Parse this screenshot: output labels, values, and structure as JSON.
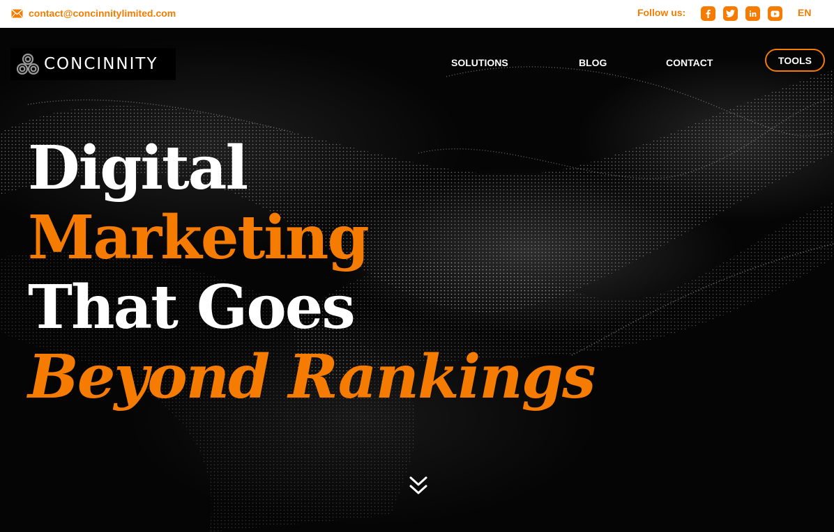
{
  "topbar": {
    "email": "contact@concinnitylimited.com",
    "email_icon": "mail-icon",
    "follow_label": "Follow us:",
    "social_icons": [
      "facebook-icon",
      "twitter-icon",
      "linkedin-icon",
      "youtube-icon"
    ],
    "language": "EN"
  },
  "brand": {
    "name": "CONCINNITY"
  },
  "nav": {
    "solutions": "SOLUTIONS",
    "blog": "BLOG",
    "contact": "CONTACT",
    "tools": "TOOLS"
  },
  "hero": {
    "line1": "Digital",
    "line2": "Marketing",
    "line3": "That Goes",
    "line4": "Beyond Rankings",
    "scroll_icon": "double-chevron-down-icon"
  },
  "colors": {
    "accent": "#f57c00",
    "text_light": "#ffffff",
    "background": "#000000"
  }
}
